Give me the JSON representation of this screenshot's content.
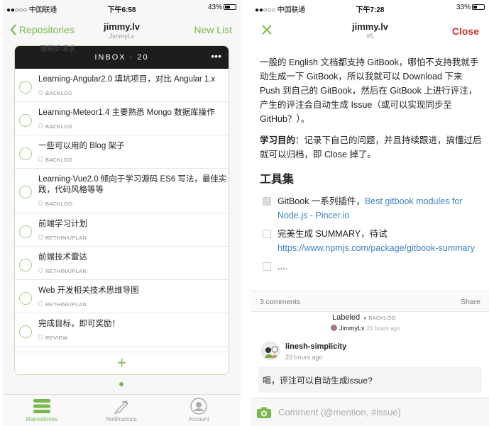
{
  "left": {
    "status": {
      "carrier": "●●○○○ 中国联通",
      "time": "下午6:58",
      "battery": "43%",
      "battery_level": 0.43
    },
    "nav": {
      "back_label": "Repositories",
      "title": "jimmy.lv",
      "subtitle": "JimmyLv",
      "right_label": "New List"
    },
    "card": {
      "header": "INBOX · 20",
      "menu": "•••",
      "ghost": "理解步请求",
      "items": [
        {
          "title": "Learning-Angular2.0 填坑项目，对比 Angular 1.x",
          "label": "BACKLOG"
        },
        {
          "title": "Learning-Meteor1.4 主要熟悉 Mongo 数据库操作",
          "label": "BACKLOG"
        },
        {
          "title": "一些可以用的 Blog 架子",
          "label": "BACKLOG"
        },
        {
          "title": "Learning-Vue2.0 倾向于学习源码 ES6 写法，最佳实践，代码风格等等",
          "label": "BACKLOG"
        },
        {
          "title": "前端学习计划",
          "label": "RETHINK/PLAN"
        },
        {
          "title": "前端技术雷达",
          "label": "RETHINK/PLAN"
        },
        {
          "title": "Web 开发相关技术思维导图",
          "label": "RETHINK/PLAN"
        },
        {
          "title": "完成目标，即可奖励！",
          "label": "REVIEW"
        }
      ],
      "add": "+"
    },
    "tabs": [
      {
        "label": "Repositories",
        "icon": "repositories-icon"
      },
      {
        "label": "Notifications",
        "icon": "notifications-icon"
      },
      {
        "label": "Account",
        "icon": "account-icon"
      }
    ]
  },
  "right": {
    "status": {
      "carrier": "●●○○○ 中国联通",
      "time": "下午7:28",
      "battery": "33%",
      "battery_level": 0.33
    },
    "nav": {
      "title": "jimmy.lv",
      "subtitle": "#5",
      "close_label": "Close"
    },
    "body": {
      "para1": "一般的 English 文档都支持 GitBook，哪怕不支持我就手动生成一下 GitBook，所以我就可以 Download 下来 Push 到自己的 GitBook，然后在 GitBook 上进行评注，产生的评注会自动生成 Issue（或可以实现同步至GitHub？）。",
      "goal_label": "学习目的",
      "goal_text": "：记录下自己的问题，并且持续跟进，搞懂过后就可以归档，即 Close 掉了。",
      "heading": "工具集",
      "task1_text": "GitBook 一系列插件，",
      "task1_link": "Best gitbook modules for Node.js - Pincer.io",
      "task2_text": "完美生成 SUMMARY，待试",
      "task2_link": "https://www.npmjs.com/package/gitbook-summary",
      "task3_text": "...."
    },
    "meta": {
      "comments": "3 comments",
      "share": "Share"
    },
    "event": {
      "action": "Labeled",
      "label": "BACKLOG",
      "user": "JimmyLv",
      "time": "21 hours ago"
    },
    "comment": {
      "author": "linesh-simplicity",
      "time": "20 hours ago",
      "text": "嗯，评注可以自动生成issue?"
    },
    "composer": {
      "placeholder": "Comment (@mention, #issue)"
    }
  },
  "colors": {
    "accent": "#78b94c",
    "close": "#d0312d",
    "link": "#4183c4"
  }
}
